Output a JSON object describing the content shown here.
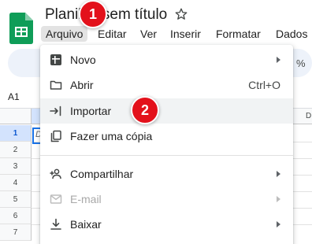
{
  "header": {
    "title": "Planilha sem título",
    "logo_icon": "google-sheets-logo",
    "star_icon": "star-outline-icon"
  },
  "menubar": {
    "items": [
      "Arquivo",
      "Editar",
      "Ver",
      "Inserir",
      "Formatar",
      "Dados"
    ]
  },
  "toolbar": {
    "zoom_suffix": "%"
  },
  "formula_bar": {
    "name_box": "A1"
  },
  "grid": {
    "column_label_visible": "D",
    "rows": [
      "1",
      "2",
      "3",
      "4",
      "5",
      "6",
      "7"
    ],
    "selected_cell_preview": "D"
  },
  "file_menu": {
    "items": [
      {
        "label": "Novo",
        "icon": "new-spreadsheet-icon",
        "submenu": true
      },
      {
        "label": "Abrir",
        "icon": "folder-open-icon",
        "shortcut": "Ctrl+O"
      },
      {
        "label": "Importar",
        "icon": "import-icon",
        "hover": true
      },
      {
        "label": "Fazer uma cópia",
        "icon": "copy-icon"
      },
      {
        "label": "Compartilhar",
        "icon": "person-add-icon",
        "submenu": true
      },
      {
        "label": "E-mail",
        "icon": "email-icon",
        "submenu": true,
        "disabled": true
      },
      {
        "label": "Baixar",
        "icon": "download-icon",
        "submenu": true
      }
    ]
  },
  "annotations": [
    {
      "number": "1",
      "target": "Arquivo menu"
    },
    {
      "number": "2",
      "target": "Importar"
    }
  ],
  "colors": {
    "badge": "#e3111b",
    "hover": "#f1f3f4",
    "selection": "#1a73e8",
    "sheets_green": "#0f9d58"
  }
}
